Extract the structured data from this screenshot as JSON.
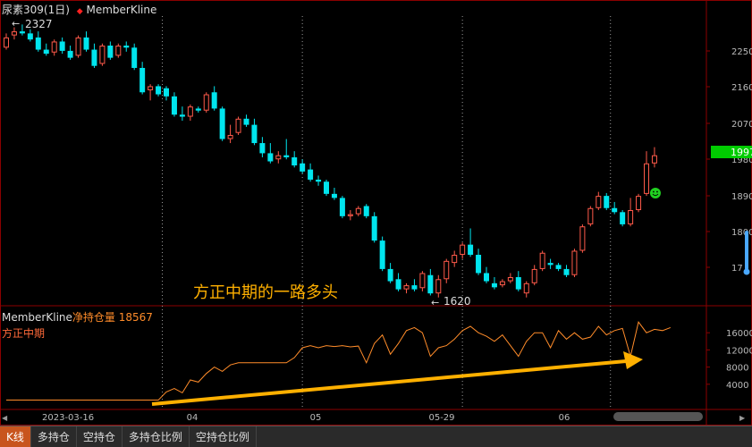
{
  "header": {
    "title": "尿素309(1日)",
    "indicator_marker": "◆",
    "indicator_name": "MemberKline"
  },
  "annotations": {
    "high_label": "2327",
    "low_label": "1620",
    "caption": "方正中期的一路多头",
    "price_badge": "1997"
  },
  "sub_panel": {
    "indicator": "MemberKline",
    "metric_label": "净持仓量",
    "metric_value": "18567",
    "member": "方正中期"
  },
  "tabs": [
    {
      "label": "K线",
      "active": true
    },
    {
      "label": "多持仓",
      "active": false
    },
    {
      "label": "空持仓",
      "active": false
    },
    {
      "label": "多持仓比例",
      "active": false
    },
    {
      "label": "空持仓比例",
      "active": false
    }
  ],
  "colors": {
    "up": "#ff5a4a",
    "down": "#00e5ee",
    "position_line": "#ff8c2a",
    "arrow": "#ffb000",
    "caption": "#ffb000",
    "badge": "#00cc00"
  },
  "chart_data": [
    {
      "type": "candlestick",
      "title": "尿素309(1日)",
      "ylim": [
        1650,
        2330
      ],
      "y_ticks": [
        "2250",
        "2160",
        "2070",
        "1980",
        "1890",
        "1800",
        "17"
      ],
      "x_ticks": [
        "2023-03-16",
        "04",
        "05",
        "05-29",
        "06"
      ],
      "high": 2327,
      "low": 1620,
      "last": 1997,
      "ohlc": [
        [
          2270,
          2305,
          2265,
          2295
        ],
        [
          2300,
          2320,
          2290,
          2310
        ],
        [
          2310,
          2327,
          2300,
          2305
        ],
        [
          2305,
          2315,
          2285,
          2290
        ],
        [
          2295,
          2310,
          2260,
          2265
        ],
        [
          2265,
          2280,
          2250,
          2255
        ],
        [
          2258,
          2290,
          2250,
          2285
        ],
        [
          2285,
          2295,
          2255,
          2262
        ],
        [
          2262,
          2275,
          2240,
          2245
        ],
        [
          2250,
          2300,
          2245,
          2295
        ],
        [
          2295,
          2310,
          2260,
          2265
        ],
        [
          2265,
          2280,
          2220,
          2225
        ],
        [
          2230,
          2280,
          2225,
          2275
        ],
        [
          2275,
          2285,
          2240,
          2245
        ],
        [
          2250,
          2280,
          2245,
          2275
        ],
        [
          2275,
          2285,
          2260,
          2270
        ],
        [
          2270,
          2280,
          2215,
          2220
        ],
        [
          2220,
          2235,
          2155,
          2160
        ],
        [
          2165,
          2180,
          2140,
          2175
        ],
        [
          2175,
          2180,
          2150,
          2155
        ],
        [
          2170,
          2175,
          2140,
          2150
        ],
        [
          2150,
          2160,
          2100,
          2105
        ],
        [
          2105,
          2125,
          2090,
          2100
        ],
        [
          2100,
          2130,
          2090,
          2125
        ],
        [
          2120,
          2125,
          2110,
          2115
        ],
        [
          2115,
          2160,
          2110,
          2155
        ],
        [
          2160,
          2175,
          2115,
          2120
        ],
        [
          2120,
          2125,
          2040,
          2045
        ],
        [
          2045,
          2080,
          2035,
          2055
        ],
        [
          2060,
          2100,
          2055,
          2095
        ],
        [
          2095,
          2105,
          2075,
          2080
        ],
        [
          2080,
          2095,
          2030,
          2035
        ],
        [
          2035,
          2050,
          2000,
          2010
        ],
        [
          2010,
          2035,
          1985,
          1990
        ],
        [
          1995,
          2015,
          1985,
          2005
        ],
        [
          2005,
          2045,
          1995,
          2000
        ],
        [
          2000,
          2015,
          1975,
          1980
        ],
        [
          1985,
          1995,
          1960,
          1965
        ],
        [
          1970,
          1985,
          1940,
          1945
        ],
        [
          1945,
          1955,
          1930,
          1940
        ],
        [
          1940,
          1945,
          1905,
          1910
        ],
        [
          1910,
          1925,
          1895,
          1900
        ],
        [
          1900,
          1905,
          1850,
          1855
        ],
        [
          1855,
          1870,
          1845,
          1860
        ],
        [
          1860,
          1880,
          1855,
          1875
        ],
        [
          1880,
          1885,
          1850,
          1855
        ],
        [
          1855,
          1865,
          1790,
          1795
        ],
        [
          1795,
          1805,
          1720,
          1725
        ],
        [
          1725,
          1740,
          1690,
          1695
        ],
        [
          1700,
          1715,
          1670,
          1675
        ],
        [
          1675,
          1690,
          1665,
          1685
        ],
        [
          1685,
          1700,
          1670,
          1675
        ],
        [
          1678,
          1720,
          1670,
          1715
        ],
        [
          1710,
          1725,
          1660,
          1665
        ],
        [
          1665,
          1710,
          1655,
          1700
        ],
        [
          1700,
          1750,
          1690,
          1745
        ],
        [
          1740,
          1770,
          1730,
          1760
        ],
        [
          1760,
          1790,
          1750,
          1785
        ],
        [
          1785,
          1825,
          1755,
          1760
        ],
        [
          1760,
          1775,
          1710,
          1715
        ],
        [
          1715,
          1730,
          1690,
          1695
        ],
        [
          1690,
          1705,
          1675,
          1680
        ],
        [
          1685,
          1700,
          1680,
          1695
        ],
        [
          1695,
          1715,
          1690,
          1705
        ],
        [
          1705,
          1720,
          1670,
          1675
        ],
        [
          1665,
          1695,
          1655,
          1690
        ],
        [
          1690,
          1735,
          1685,
          1725
        ],
        [
          1725,
          1770,
          1720,
          1765
        ],
        [
          1740,
          1750,
          1725,
          1735
        ],
        [
          1735,
          1740,
          1720,
          1725
        ],
        [
          1725,
          1735,
          1705,
          1710
        ],
        [
          1710,
          1775,
          1705,
          1770
        ],
        [
          1770,
          1835,
          1765,
          1830
        ],
        [
          1835,
          1880,
          1830,
          1875
        ],
        [
          1875,
          1915,
          1870,
          1905
        ],
        [
          1905,
          1912,
          1870,
          1875
        ],
        [
          1875,
          1890,
          1860,
          1865
        ],
        [
          1865,
          1870,
          1830,
          1835
        ],
        [
          1835,
          1900,
          1830,
          1870
        ],
        [
          1870,
          1910,
          1865,
          1905
        ],
        [
          1910,
          2015,
          1905,
          1985
        ],
        [
          1985,
          2025,
          1975,
          2005
        ]
      ]
    },
    {
      "type": "line",
      "series": [
        {
          "name": "净持仓量"
        }
      ],
      "ylim": [
        0,
        20000
      ],
      "y_ticks": [
        16000,
        12000,
        8000,
        4000
      ],
      "values": [
        300,
        300,
        300,
        300,
        300,
        300,
        300,
        300,
        300,
        300,
        300,
        300,
        300,
        300,
        300,
        300,
        300,
        300,
        300,
        300,
        2200,
        3000,
        2000,
        5000,
        4500,
        6500,
        8000,
        7000,
        8500,
        9000,
        9000,
        9000,
        9000,
        9000,
        9000,
        9000,
        10200,
        12500,
        13000,
        12500,
        13000,
        12800,
        13000,
        12700,
        12900,
        9000,
        13500,
        15500,
        11000,
        13500,
        16500,
        17200,
        16000,
        10500,
        12500,
        13000,
        14500,
        16500,
        17500,
        16000,
        15200,
        14000,
        15500,
        13000,
        10500,
        14000,
        16000,
        16000,
        12500,
        16500,
        14500,
        16000,
        14500,
        15000,
        17500,
        15500,
        16500,
        17000,
        10500,
        18500,
        16000,
        16800,
        16500,
        17200
      ]
    }
  ]
}
